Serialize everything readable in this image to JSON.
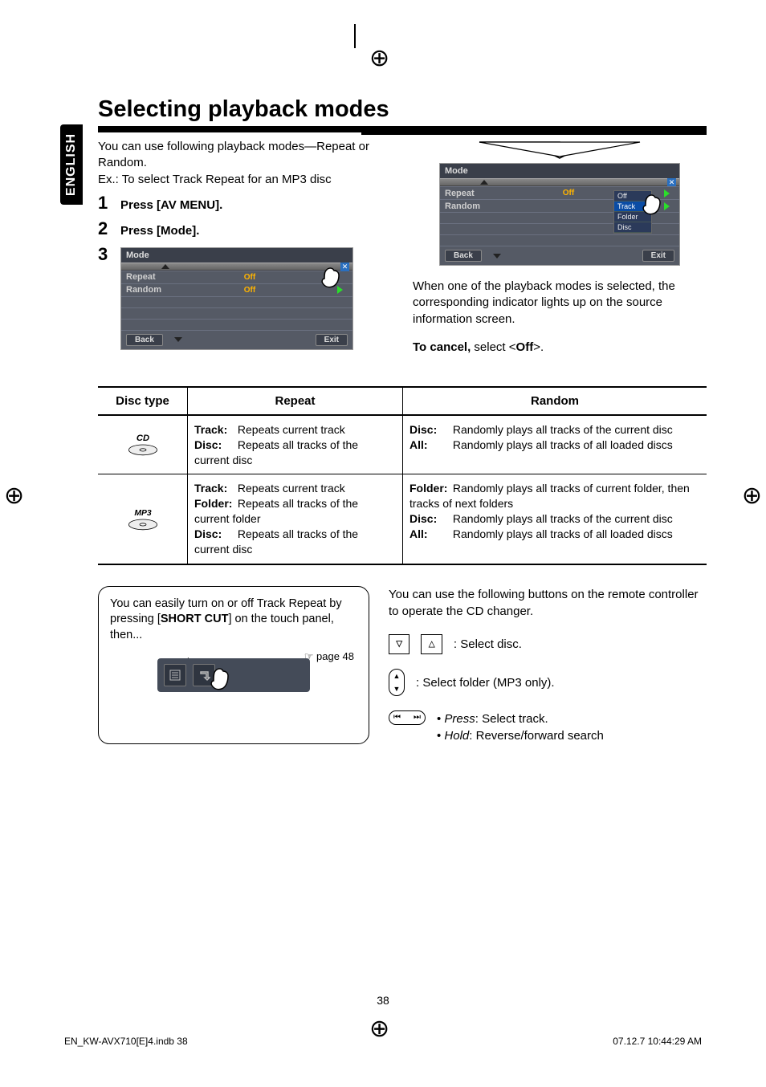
{
  "lang_tab": "ENGLISH",
  "heading": "Selecting playback modes",
  "intro": "You can use following playback modes—Repeat or Random.",
  "example": "Ex.: To select Track Repeat for an MP3 disc",
  "steps": {
    "s1": "Press [AV MENU].",
    "s2": "Press [Mode].",
    "s3": ""
  },
  "screen": {
    "title": "Mode",
    "repeat_label": "Repeat",
    "random_label": "Random",
    "val_off": "Off",
    "back": "Back",
    "exit": "Exit",
    "dropdown": {
      "off": "Off",
      "track": "Track",
      "folder": "Folder",
      "disc": "Disc"
    }
  },
  "note": "When one of the playback modes is selected, the corresponding indicator lights up on the source information screen.",
  "cancel_prefix": "To cancel,",
  "cancel_rest": " select <",
  "cancel_off": "Off",
  "cancel_end": ">.",
  "table": {
    "head": {
      "c1": "Disc type",
      "c2": "Repeat",
      "c3": "Random"
    },
    "cd_label": "CD",
    "mp3_label": "MP3",
    "cd": {
      "repeat_track_k": "Track:",
      "repeat_track_v": "Repeats current track",
      "repeat_disc_k": "Disc:",
      "repeat_disc_v": "Repeats all tracks of the current disc",
      "random_disc_k": "Disc:",
      "random_disc_v": "Randomly plays all tracks of the current disc",
      "random_all_k": "All:",
      "random_all_v": "Randomly plays all tracks of all loaded discs"
    },
    "mp3": {
      "repeat_track_k": "Track:",
      "repeat_track_v": "Repeats current track",
      "repeat_folder_k": "Folder:",
      "repeat_folder_v": "Repeats all tracks of the current folder",
      "repeat_disc_k": "Disc:",
      "repeat_disc_v": "Repeats all tracks of the current disc",
      "random_folder_k": "Folder:",
      "random_folder_v": "Randomly plays all tracks of current folder, then tracks of next folders",
      "random_disc_k": "Disc:",
      "random_disc_v": "Randomly plays all tracks of the current disc",
      "random_all_k": "All:",
      "random_all_v": "Randomly plays all tracks of all loaded discs"
    }
  },
  "shortcut": {
    "line1_a": "You can easily turn on or off Track Repeat by pressing [",
    "line1_b": "SHORT CUT",
    "line1_c": "] on the touch panel, then...",
    "page_ref": "page 48"
  },
  "remote": {
    "intro": "You can use the following buttons on the remote controller to operate the CD changer.",
    "select_disc": "Select disc.",
    "select_folder": "Select folder (MP3 only).",
    "press_k": "Press",
    "press_v": ": Select track.",
    "hold_k": "Hold",
    "hold_v": ": Reverse/forward search"
  },
  "page_num": "38",
  "footer": {
    "file": "EN_KW-AVX710[E]4.indb   38",
    "time": "07.12.7   10:44:29 AM"
  }
}
